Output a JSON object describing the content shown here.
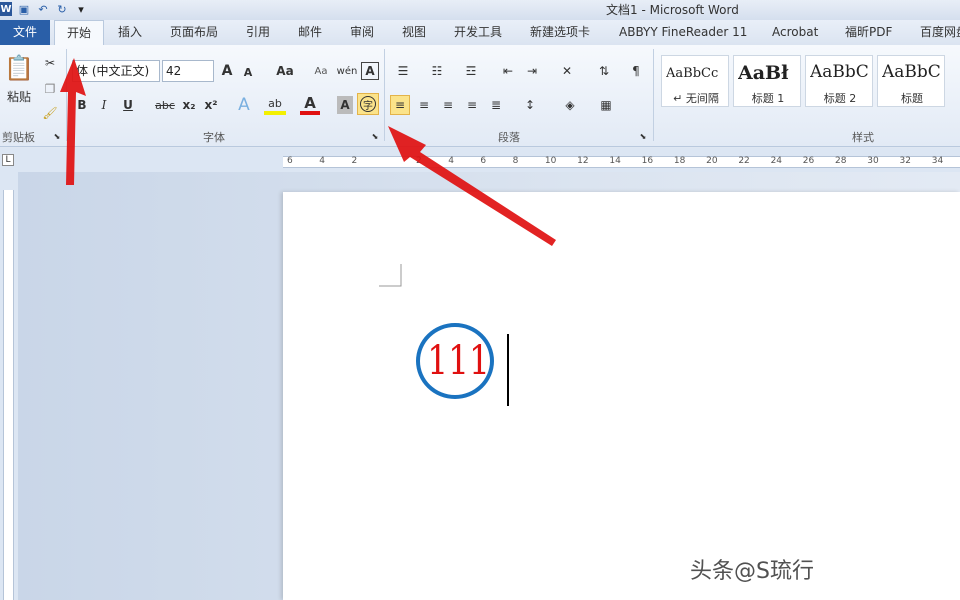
{
  "window": {
    "title": "文档1 - Microsoft Word"
  },
  "qat": {
    "logo": "W",
    "undo": "↶",
    "redo": "↻"
  },
  "tabs": [
    "文件",
    "开始",
    "插入",
    "页面布局",
    "引用",
    "邮件",
    "审阅",
    "视图",
    "开发工具",
    "新建选项卡",
    "ABBYY FineReader 11",
    "Acrobat",
    "福昕PDF",
    "百度网盘"
  ],
  "font": {
    "name": "体 (中文正文)",
    "size": "42"
  },
  "groups": {
    "clipboard": "剪贴板",
    "font": "字体",
    "paragraph": "段落",
    "styles": "样式"
  },
  "clipboard": {
    "paste": "粘贴"
  },
  "buttons": {
    "bold": "B",
    "italic": "I",
    "underline": "U",
    "strike": "abc",
    "sub": "x₂",
    "sup": "x²",
    "grow": "A",
    "shrink": "A",
    "case": "Aa",
    "pinyin": "wén",
    "border": "A",
    "enclose": "字",
    "fontcolor": "A",
    "shade": "A"
  },
  "styles": [
    {
      "sample": "AaBbCc",
      "name": "↵ 无间隔"
    },
    {
      "sample": "AaBł",
      "name": "标题 1"
    },
    {
      "sample": "AaBbC",
      "name": "标题 2"
    },
    {
      "sample": "AaBbC",
      "name": "标题"
    }
  ],
  "ruler": {
    "h": [
      "6",
      "4",
      "2",
      "",
      "2",
      "4",
      "6",
      "8",
      "10",
      "12",
      "14",
      "16",
      "18",
      "20",
      "22",
      "24",
      "26",
      "28",
      "30",
      "32",
      "34"
    ]
  },
  "document": {
    "text": "111"
  },
  "watermark": "头条@S琉行",
  "colors": {
    "accent": "#2a5fa8",
    "arrow": "#e01010",
    "circle": "#1a73c0",
    "text": "#e01010"
  }
}
